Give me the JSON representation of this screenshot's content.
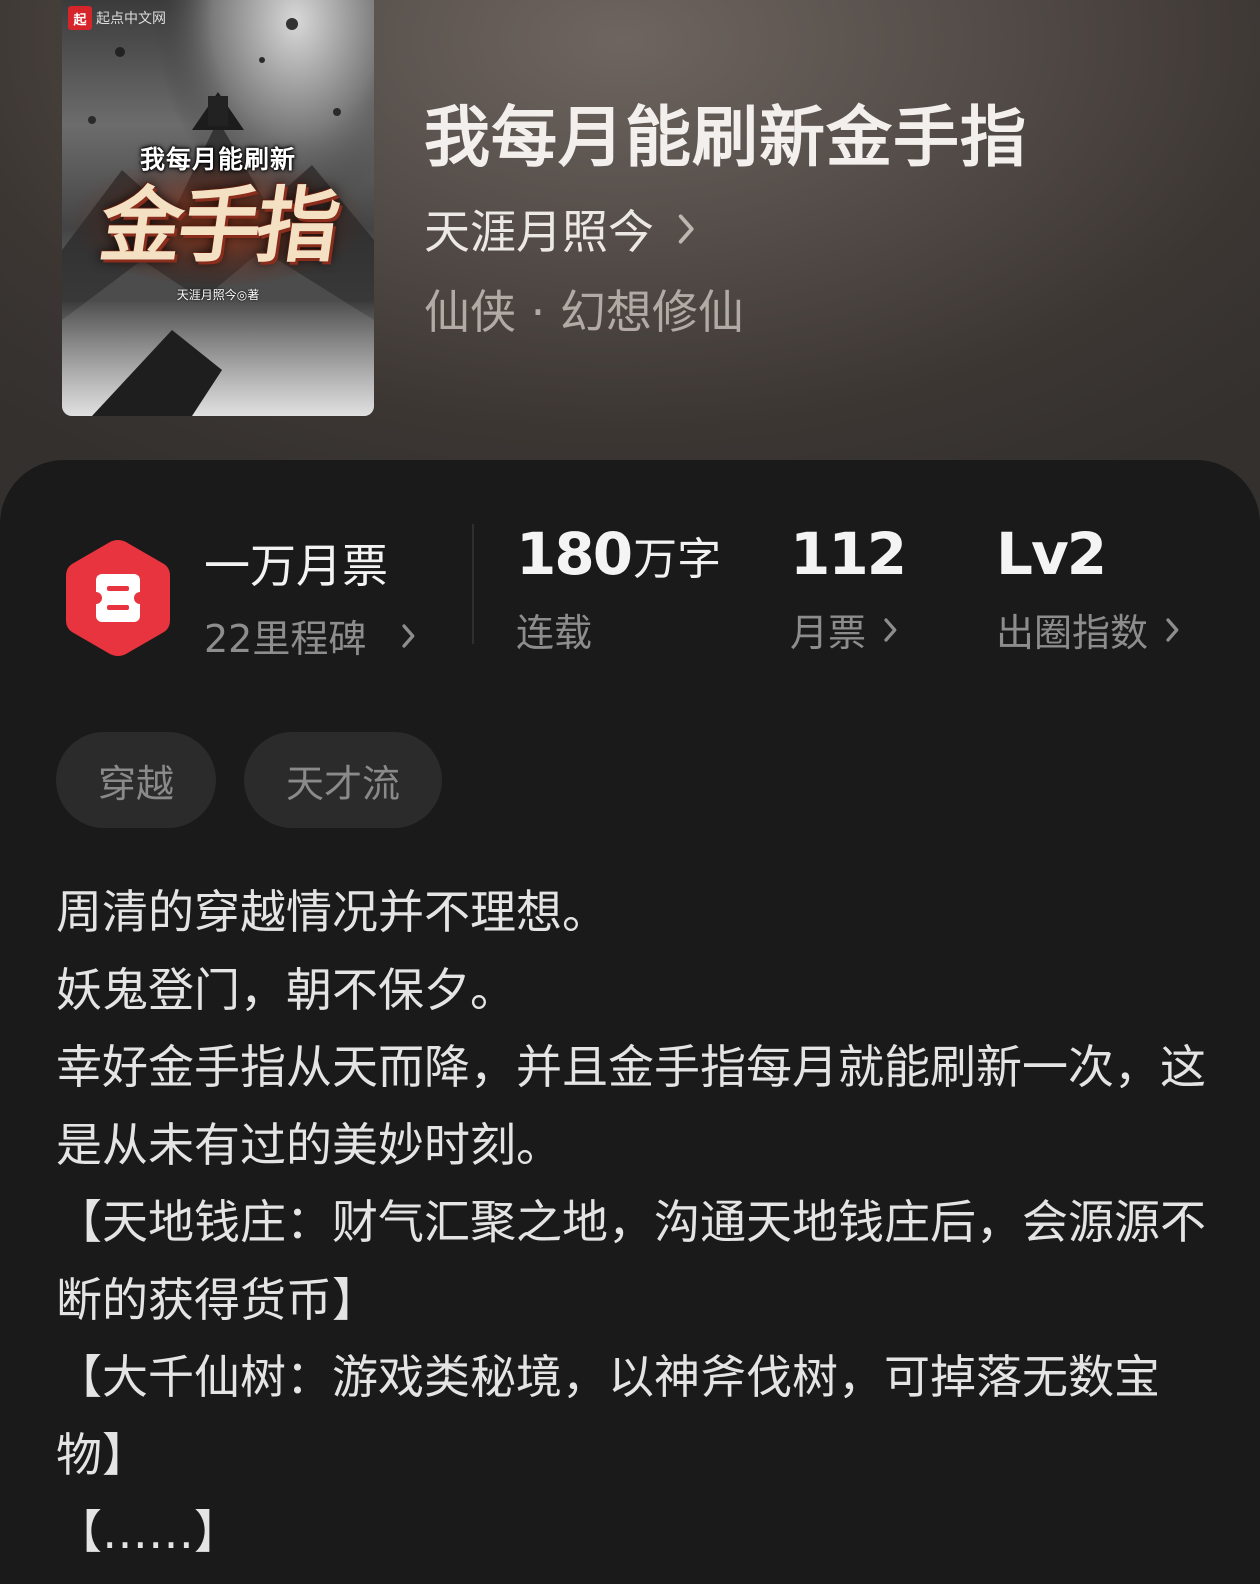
{
  "book": {
    "title": "我每月能刷新金手指",
    "author": "天涯月照今",
    "genre": "仙侠 · 幻想修仙"
  },
  "cover": {
    "publisher_badge": "起",
    "publisher_name": "起点中文网",
    "subtitle_text": "我每月能刷新",
    "title_text": "金手指",
    "author_text": "天涯月照今◎著"
  },
  "stats": {
    "milestone": {
      "title": "一万月票",
      "subtitle": "22里程碑"
    },
    "word_count": {
      "number": "180",
      "unit": "万字",
      "label": "连载"
    },
    "monthly_votes": {
      "number": "112",
      "label": "月票"
    },
    "level": {
      "number": "Lv2",
      "label": "出圈指数"
    }
  },
  "tags": [
    "穿越",
    "天才流"
  ],
  "synopsis": {
    "lines": [
      "周清的穿越情况并不理想。",
      "妖鬼登门，朝不保夕。",
      "幸好金手指从天而降，并且金手指每月就能刷新一次，这是从未有过的美妙时刻。",
      "【天地钱庄：财气汇聚之地，沟通天地钱庄后，会源源不断的获得货币】",
      "【大千仙树：游戏类秘境，以神斧伐树，可掉落无数宝物】",
      "【……】"
    ]
  },
  "colors": {
    "background": "#1a1a1a",
    "hero_top": "#6e6560",
    "hero_bottom": "#33302e",
    "milestone_icon": "#e8343e",
    "tag_background": "#2b2b2b",
    "secondary_text": "#8d8d8d"
  },
  "icons": {
    "milestone": "ticket-hexagon-icon",
    "chevron": "chevron-right-icon"
  }
}
